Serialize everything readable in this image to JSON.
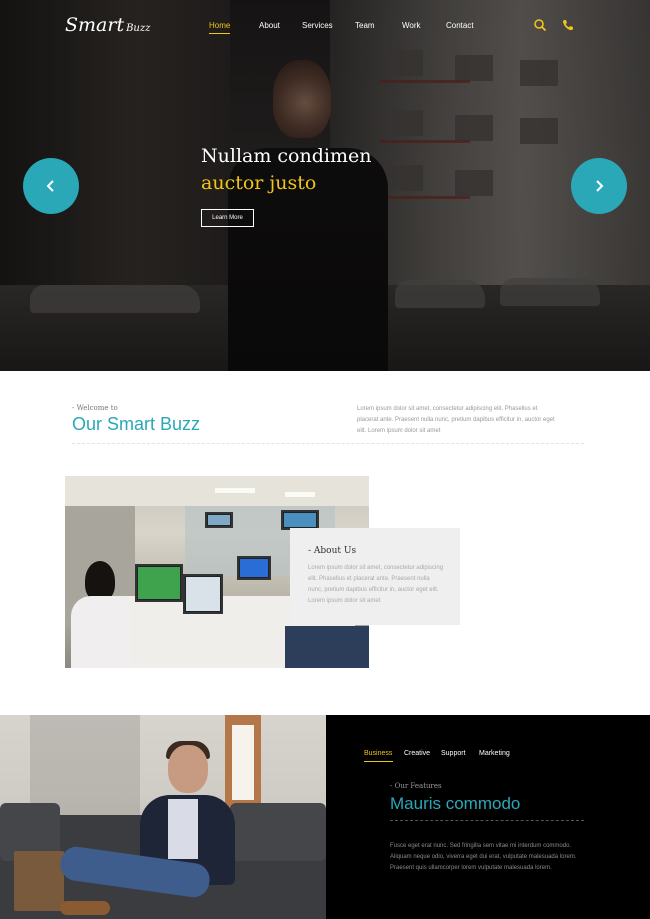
{
  "brand": {
    "name_main": "Smart",
    "name_sub": "Buzz"
  },
  "nav": {
    "items": [
      {
        "label": "Home",
        "active": true
      },
      {
        "label": "About",
        "active": false
      },
      {
        "label": "Services",
        "active": false
      },
      {
        "label": "Team",
        "active": false
      },
      {
        "label": "Work",
        "active": false
      },
      {
        "label": "Contact",
        "active": false
      }
    ],
    "icons": [
      "search-icon",
      "phone-icon"
    ]
  },
  "hero": {
    "title": "Nullam condimen",
    "subtitle": "auctor justo",
    "button_label": "Learn More",
    "prev_icon": "chevron-left-icon",
    "next_icon": "chevron-right-icon"
  },
  "welcome": {
    "kicker": "- Welcome to",
    "title": "Our Smart Buzz",
    "text": "Lorem ipsum dolor sit amet, consectetur adipiscing elit. Phasellus et placerat ante. Praesent nulla nunc, pretium dapibus efficitur in, auctor eget elit. Lorem ipsum dolor sit amet"
  },
  "about": {
    "title": "- About Us",
    "text": "Lorem ipsum dolor sit amet, consectetur adipiscing elit. Phasellus et placerat ante. Praesent nulla nunc, pretium dapibus efficitur in, auctor eget elit. Lorem ipsum dolor sit amet"
  },
  "features": {
    "tabs": [
      {
        "label": "Business",
        "active": true
      },
      {
        "label": "Creative",
        "active": false
      },
      {
        "label": "Support",
        "active": false
      },
      {
        "label": "Marketing",
        "active": false
      }
    ],
    "kicker": "- Our Features",
    "title": "Mauris commodo",
    "text": "Fusce eget erat nunc. Sed fringilla sem vitae mi interdum commodo. Aliquam neque odio, viverra eget dui erat, vulputate malesuada lorem. Praesent quis ullamcorper lorem vulputate malesuada lorem."
  },
  "colors": {
    "accent": "#2aa8b8",
    "highlight": "#f0c419",
    "dark": "#000000",
    "card": "#efefef"
  }
}
